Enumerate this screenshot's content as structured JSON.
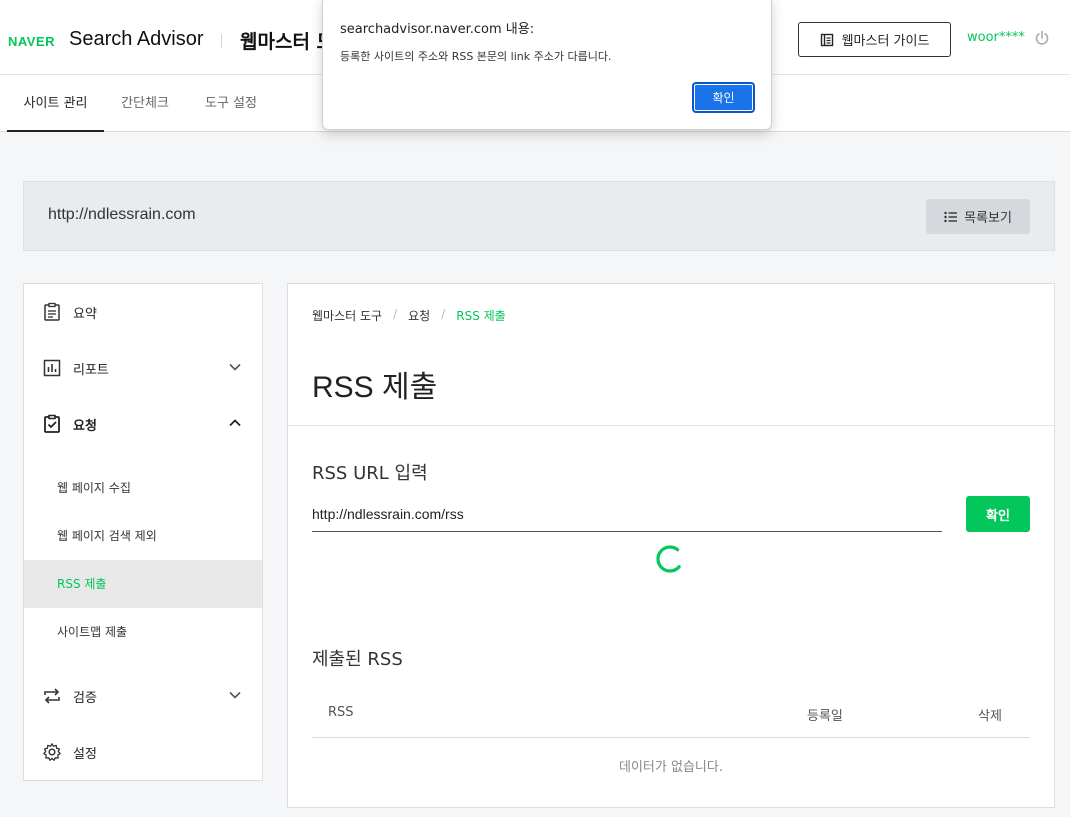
{
  "header": {
    "naver_logo": "NAVER",
    "brand": "Search Advisor",
    "title": "웹마스터 도구",
    "guide_button": "웹마스터 가이드",
    "user": "woor****"
  },
  "tabs": [
    {
      "label": "사이트 관리",
      "active": true
    },
    {
      "label": "간단체크",
      "active": false
    },
    {
      "label": "도구 설정",
      "active": false
    }
  ],
  "site": {
    "url": "http://ndlessrain.com",
    "list_button": "목록보기"
  },
  "sidebar": {
    "items": [
      {
        "label": "요약",
        "icon": "clipboard-icon"
      },
      {
        "label": "리포트",
        "icon": "chart-icon"
      },
      {
        "label": "요청",
        "icon": "clipboard-check-icon"
      },
      {
        "label": "검증",
        "icon": "repeat-icon"
      },
      {
        "label": "설정",
        "icon": "gear-icon"
      }
    ],
    "subitems": [
      {
        "label": "웹 페이지 수집"
      },
      {
        "label": "웹 페이지 검색 제외"
      },
      {
        "label": "RSS 제출"
      },
      {
        "label": "사이트맵 제출"
      }
    ]
  },
  "main": {
    "breadcrumb": [
      "웹마스터 도구",
      "요청",
      "RSS 제출"
    ],
    "title": "RSS 제출",
    "input_section": "RSS URL 입력",
    "input_value": "http://ndlessrain.com/rss",
    "confirm_button": "확인",
    "submitted_section": "제출된 RSS",
    "columns": [
      "RSS",
      "등록일",
      "삭제"
    ],
    "empty_message": "데이터가 없습니다."
  },
  "dialog": {
    "title": "searchadvisor.naver.com 내용:",
    "message": "등록한 사이트의 주소와 RSS 본문의 link 주소가 다릅니다.",
    "ok_button": "확인"
  },
  "colors": {
    "brand_green": "#03c75a",
    "dialog_blue": "#1a73e8"
  }
}
